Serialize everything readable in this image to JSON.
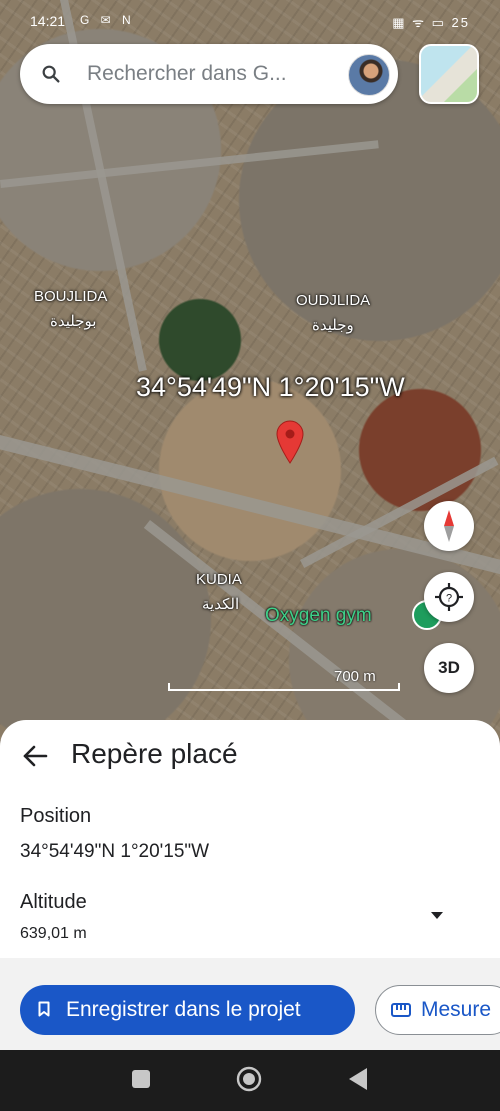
{
  "status_bar": {
    "time": "14:21",
    "notif_icons": "G ✉ N",
    "right_info": "▦ ᯤ ▭ 25"
  },
  "search": {
    "placeholder": "Rechercher dans G..."
  },
  "map": {
    "places": [
      {
        "name": "BOUJLIDA",
        "arabic": "بوجليدة"
      },
      {
        "name": "OUDJLIDA",
        "arabic": "وجليدة"
      },
      {
        "name": "KUDIA",
        "arabic": "الكدية"
      }
    ],
    "coordinates_label": "34°54'49\"N 1°20'15\"W",
    "poi": "Oxygen gym",
    "scale": "700 m",
    "three_d_label": "3D"
  },
  "sheet": {
    "title": "Repère placé",
    "position_label": "Position",
    "position_value": "34°54'49\"N 1°20'15\"W",
    "altitude_label": "Altitude",
    "altitude_value": "639,01 m"
  },
  "actions": {
    "save_label": "Enregistrer dans le projet",
    "measure_label": "Mesure"
  },
  "colors": {
    "primary": "#1a57c7",
    "pin": "#e53935",
    "poi": "#3ed089"
  }
}
